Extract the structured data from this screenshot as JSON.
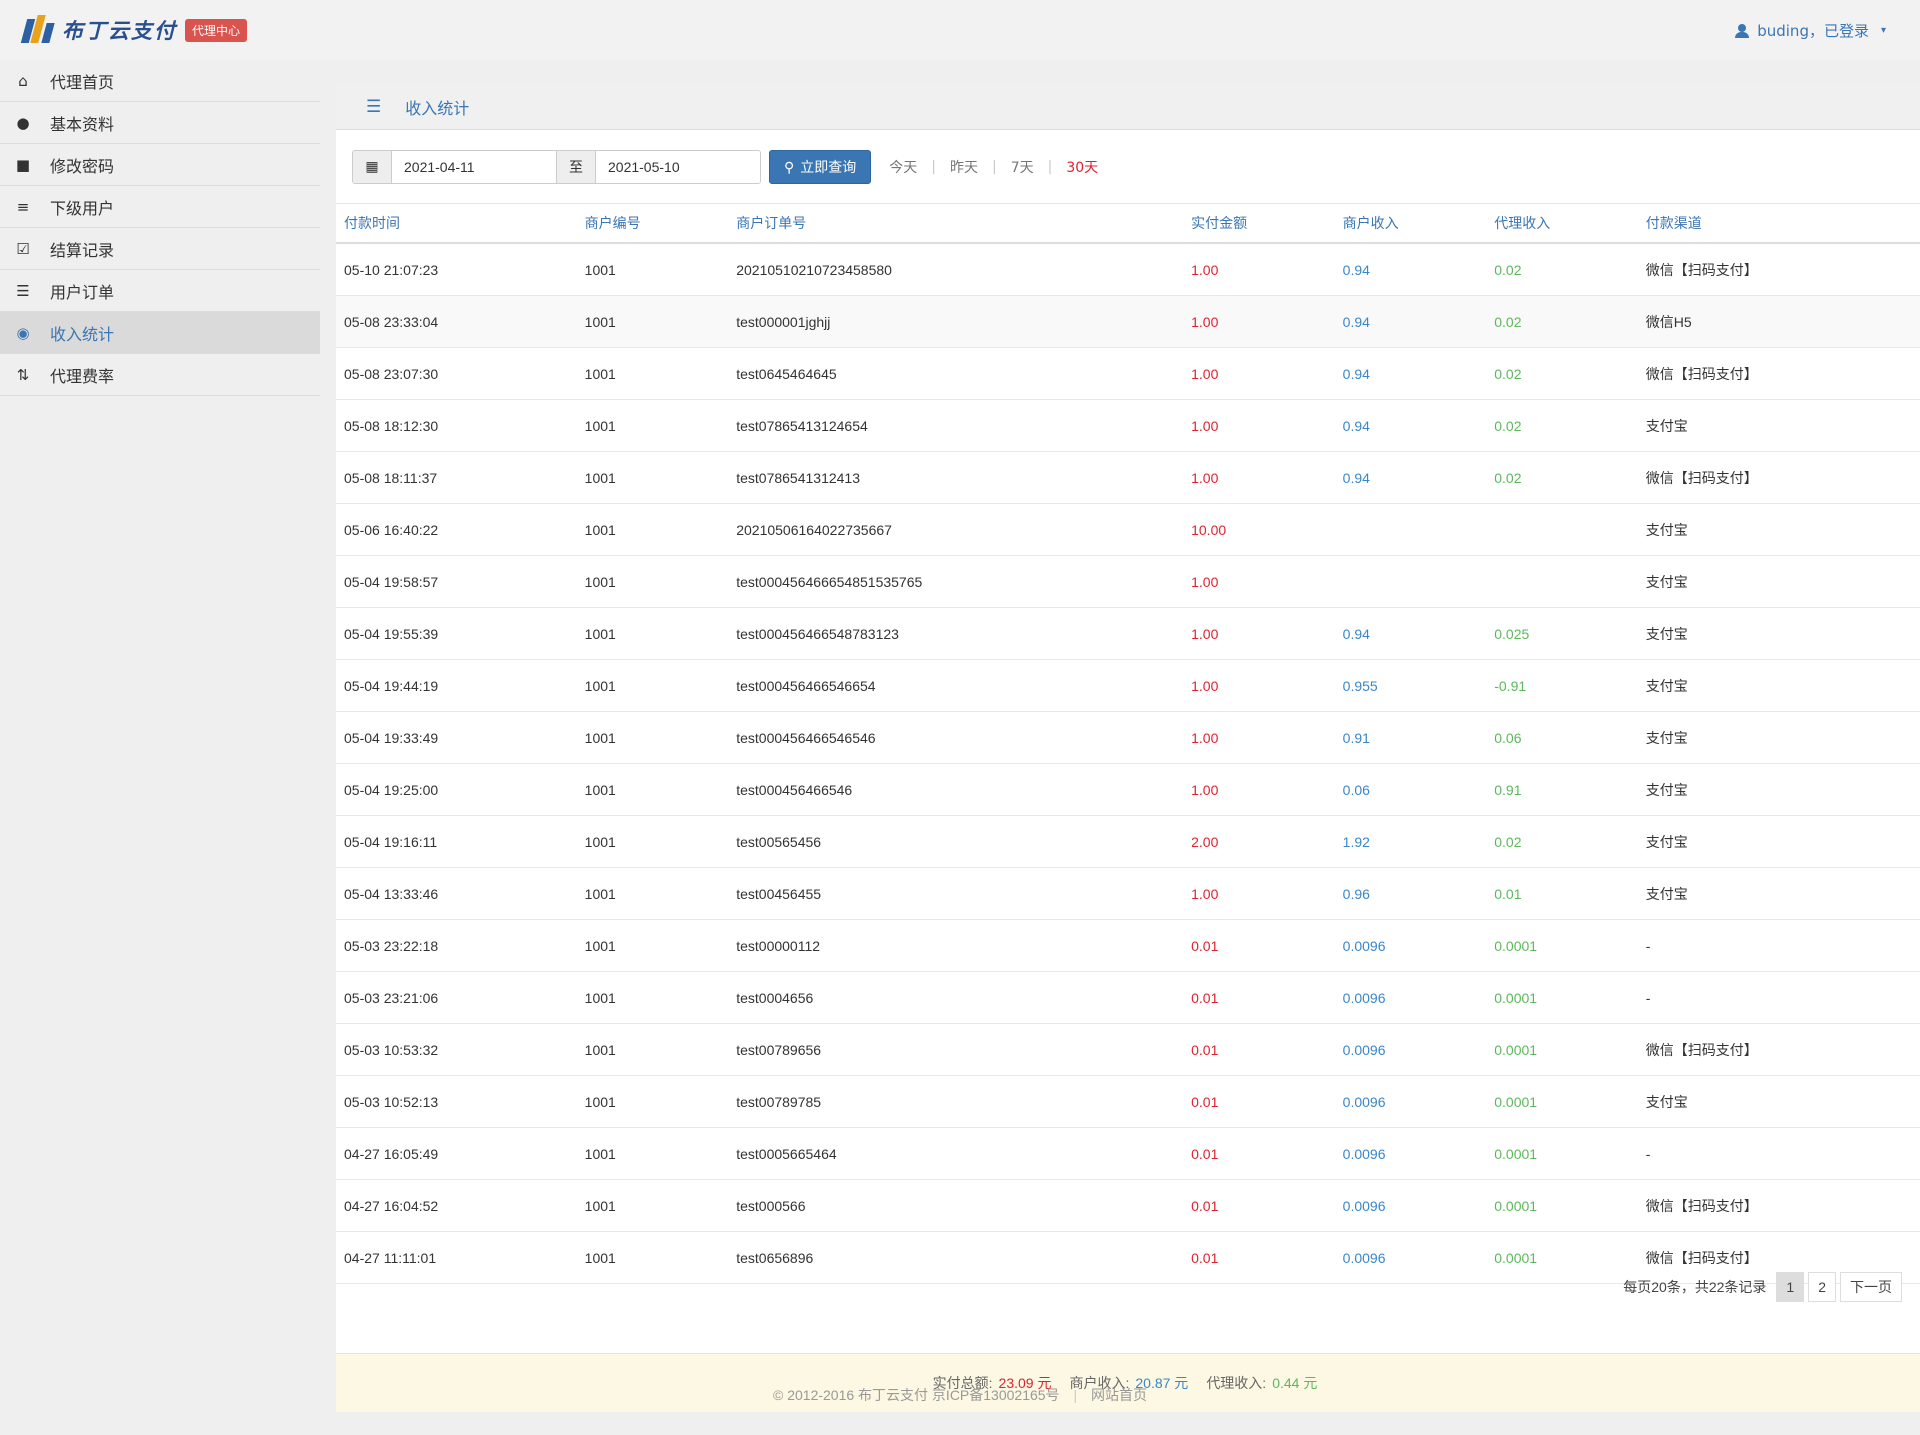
{
  "header": {
    "logo_text": "布丁云支付",
    "badge": "代理中心",
    "user": "buding，已登录",
    "caret": "▾"
  },
  "sidebar": {
    "items": [
      {
        "label": "代理首页",
        "icon": "home-icon",
        "glyph": "⌂"
      },
      {
        "label": "基本资料",
        "icon": "user-icon",
        "glyph": "●"
      },
      {
        "label": "修改密码",
        "icon": "lock-icon",
        "glyph": "■"
      },
      {
        "label": "下级用户",
        "icon": "menu-icon",
        "glyph": "≡"
      },
      {
        "label": "结算记录",
        "icon": "check-icon",
        "glyph": "☑"
      },
      {
        "label": "用户订单",
        "icon": "list-icon",
        "glyph": "☰"
      },
      {
        "label": "收入统计",
        "icon": "piggy-bank-icon",
        "glyph": "◉"
      },
      {
        "label": "代理费率",
        "icon": "sort-icon",
        "glyph": "⇅"
      }
    ],
    "active_index": 6
  },
  "panel": {
    "title": "收入统计",
    "title_glyph": "☰"
  },
  "filter": {
    "start_date": "2021-04-11",
    "to": "至",
    "end_date": "2021-05-10",
    "query_button": "立即查询",
    "quick": [
      "今天",
      "昨天",
      "7天",
      "30天"
    ],
    "quick_active": 3
  },
  "table": {
    "columns": [
      "付款时间",
      "商户编号",
      "商户订单号",
      "实付金额",
      "商户收入",
      "代理收入",
      "付款渠道"
    ],
    "rows": [
      [
        "05-10 21:07:23",
        "1001",
        "20210510210723458580",
        "1.00",
        "0.94",
        "0.02",
        "微信【扫码支付】"
      ],
      [
        "05-08 23:33:04",
        "1001",
        "test000001jghjj",
        "1.00",
        "0.94",
        "0.02",
        "微信H5"
      ],
      [
        "05-08 23:07:30",
        "1001",
        "test0645464645",
        "1.00",
        "0.94",
        "0.02",
        "微信【扫码支付】"
      ],
      [
        "05-08 18:12:30",
        "1001",
        "test07865413124654",
        "1.00",
        "0.94",
        "0.02",
        "支付宝"
      ],
      [
        "05-08 18:11:37",
        "1001",
        "test0786541312413",
        "1.00",
        "0.94",
        "0.02",
        "微信【扫码支付】"
      ],
      [
        "05-06 16:40:22",
        "1001",
        "20210506164022735667",
        "10.00",
        "",
        "",
        "支付宝"
      ],
      [
        "05-04 19:58:57",
        "1001",
        "test000456466654851535765",
        "1.00",
        "",
        "",
        "支付宝"
      ],
      [
        "05-04 19:55:39",
        "1001",
        "test000456466548783123",
        "1.00",
        "0.94",
        "0.025",
        "支付宝"
      ],
      [
        "05-04 19:44:19",
        "1001",
        "test000456466546654",
        "1.00",
        "0.955",
        "-0.91",
        "支付宝"
      ],
      [
        "05-04 19:33:49",
        "1001",
        "test000456466546546",
        "1.00",
        "0.91",
        "0.06",
        "支付宝"
      ],
      [
        "05-04 19:25:00",
        "1001",
        "test000456466546",
        "1.00",
        "0.06",
        "0.91",
        "支付宝"
      ],
      [
        "05-04 19:16:11",
        "1001",
        "test00565456",
        "2.00",
        "1.92",
        "0.02",
        "支付宝"
      ],
      [
        "05-04 13:33:46",
        "1001",
        "test00456455",
        "1.00",
        "0.96",
        "0.01",
        "支付宝"
      ],
      [
        "05-03 23:22:18",
        "1001",
        "test00000112",
        "0.01",
        "0.0096",
        "0.0001",
        "-"
      ],
      [
        "05-03 23:21:06",
        "1001",
        "test0004656",
        "0.01",
        "0.0096",
        "0.0001",
        "-"
      ],
      [
        "05-03 10:53:32",
        "1001",
        "test00789656",
        "0.01",
        "0.0096",
        "0.0001",
        "微信【扫码支付】"
      ],
      [
        "05-03 10:52:13",
        "1001",
        "test00789785",
        "0.01",
        "0.0096",
        "0.0001",
        "支付宝"
      ],
      [
        "04-27 16:05:49",
        "1001",
        "test0005665464",
        "0.01",
        "0.0096",
        "0.0001",
        "-"
      ],
      [
        "04-27 16:04:52",
        "1001",
        "test000566",
        "0.01",
        "0.0096",
        "0.0001",
        "微信【扫码支付】"
      ],
      [
        "04-27 11:11:01",
        "1001",
        "test0656896",
        "0.01",
        "0.0096",
        "0.0001",
        "微信【扫码支付】"
      ]
    ]
  },
  "pager": {
    "info": "每页20条，共22条记录",
    "pages": [
      "1",
      "2"
    ],
    "current": "1",
    "next": "下一页"
  },
  "summary": {
    "total_label": "实付总额:",
    "total": "23.09 元",
    "merchant_label": "商户收入:",
    "merchant": "20.87 元",
    "agent_label": "代理收入:",
    "agent": "0.44 元"
  },
  "footer": {
    "copyright": "© 2012-2016 布丁云支付 京ICP备13002165号",
    "site_link": "网站首页"
  },
  "colors": {
    "brand": "#3a76b4",
    "amount": "#e0212f",
    "merchant": "#3a86c8",
    "agent": "#5cb85c"
  }
}
